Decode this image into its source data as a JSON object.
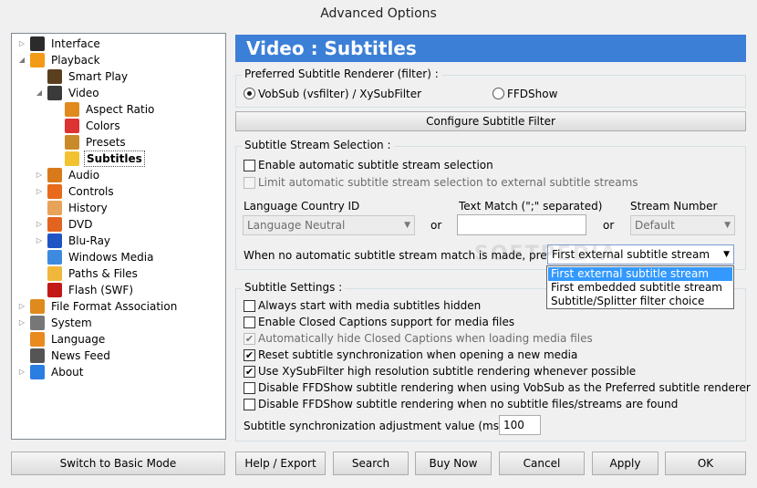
{
  "window": {
    "title": "Advanced Options"
  },
  "tree": [
    {
      "label": "Interface",
      "icon": "interface-icon",
      "color": "#2b2b2b",
      "exp": "right"
    },
    {
      "label": "Playback",
      "icon": "playback-icon",
      "color": "#f39a16",
      "exp": "down"
    },
    {
      "label": "Smart Play",
      "icon": "smart-play-icon",
      "color": "#5a3f1f",
      "exp": ""
    },
    {
      "label": "Video",
      "icon": "video-icon",
      "color": "#3a3a3a",
      "exp": "down"
    },
    {
      "label": "Aspect Ratio",
      "icon": "aspect-ratio-icon",
      "color": "#e08a1e",
      "exp": ""
    },
    {
      "label": "Colors",
      "icon": "colors-icon",
      "color": "#d33",
      "exp": ""
    },
    {
      "label": "Presets",
      "icon": "presets-icon",
      "color": "#c98a2a",
      "exp": ""
    },
    {
      "label": "Subtitles",
      "icon": "subtitles-icon",
      "color": "#f2c230",
      "exp": "",
      "selected": true
    },
    {
      "label": "Audio",
      "icon": "audio-icon",
      "color": "#d97a1a",
      "exp": "right"
    },
    {
      "label": "Controls",
      "icon": "controls-icon",
      "color": "#e86a1a",
      "exp": "right"
    },
    {
      "label": "History",
      "icon": "history-icon",
      "color": "#e7a35a",
      "exp": ""
    },
    {
      "label": "DVD",
      "icon": "dvd-icon",
      "color": "#e2641e",
      "exp": "right"
    },
    {
      "label": "Blu-Ray",
      "icon": "bluray-icon",
      "color": "#1e55c4",
      "exp": "right"
    },
    {
      "label": "Windows Media",
      "icon": "windows-media-icon",
      "color": "#3d8ae0",
      "exp": ""
    },
    {
      "label": "Paths & Files",
      "icon": "folder-icon",
      "color": "#f0b73a",
      "exp": ""
    },
    {
      "label": "Flash (SWF)",
      "icon": "flash-icon",
      "color": "#c21818",
      "exp": ""
    },
    {
      "label": "File Format Association",
      "icon": "file-association-icon",
      "color": "#e08a1e",
      "exp": "right"
    },
    {
      "label": "System",
      "icon": "system-gear-icon",
      "color": "#777",
      "exp": "right"
    },
    {
      "label": "Language",
      "icon": "language-icon",
      "color": "#e88a1e",
      "exp": ""
    },
    {
      "label": "News Feed",
      "icon": "news-feed-icon",
      "color": "#555",
      "exp": ""
    },
    {
      "label": "About",
      "icon": "about-icon",
      "color": "#2a7de1",
      "exp": "right"
    }
  ],
  "header": {
    "title": "Video : Subtitles"
  },
  "renderer": {
    "group_title": "Preferred Subtitle Renderer (filter) :",
    "opt1": "VobSub (vsfilter)  /  XySubFilter",
    "opt2": "FFDShow",
    "configure_button": "Configure Subtitle Filter"
  },
  "stream": {
    "group_title": "Subtitle Stream Selection :",
    "enable_auto": "Enable automatic subtitle stream selection",
    "limit_auto": "Limit automatic subtitle stream selection to external subtitle streams",
    "lang_label": "Language Country ID",
    "lang_value": "Language Neutral",
    "or1": "or",
    "text_label": "Text Match (\";\" separated)",
    "text_value": "",
    "or2": "or",
    "stream_label": "Stream Number",
    "stream_value": "Default",
    "nomatch_label": "When no automatic subtitle stream match is made, prefer",
    "nomatch_value": "First external subtitle stream",
    "nomatch_options": [
      "First external subtitle stream",
      "First embedded subtitle stream",
      "Subtitle/Splitter filter choice"
    ]
  },
  "settings": {
    "group_title": "Subtitle Settings :",
    "items": [
      {
        "label": "Always start with media subtitles hidden",
        "checked": false,
        "disabled": false
      },
      {
        "label": "Enable Closed Captions support for media files",
        "checked": false,
        "disabled": false
      },
      {
        "label": "Automatically hide Closed Captions when loading media files",
        "checked": true,
        "disabled": true
      },
      {
        "label": "Reset subtitle synchronization when opening a new media",
        "checked": true,
        "disabled": false
      },
      {
        "label": "Use XySubFilter high resolution subtitle rendering whenever possible",
        "checked": true,
        "disabled": false
      },
      {
        "label": "Disable FFDShow subtitle rendering when using VobSub as the Preferred subtitle renderer",
        "checked": false,
        "disabled": false
      },
      {
        "label": "Disable FFDShow subtitle rendering when no subtitle files/streams are found",
        "checked": false,
        "disabled": false
      }
    ],
    "sync_label": "Subtitle synchronization adjustment value (ms)",
    "sync_value": "100"
  },
  "footer": {
    "switch_basic": "Switch to Basic Mode",
    "help": "Help / Export",
    "search": "Search",
    "buy": "Buy Now",
    "cancel": "Cancel",
    "apply": "Apply",
    "ok": "OK"
  },
  "watermark": "SOFTPEDIA"
}
